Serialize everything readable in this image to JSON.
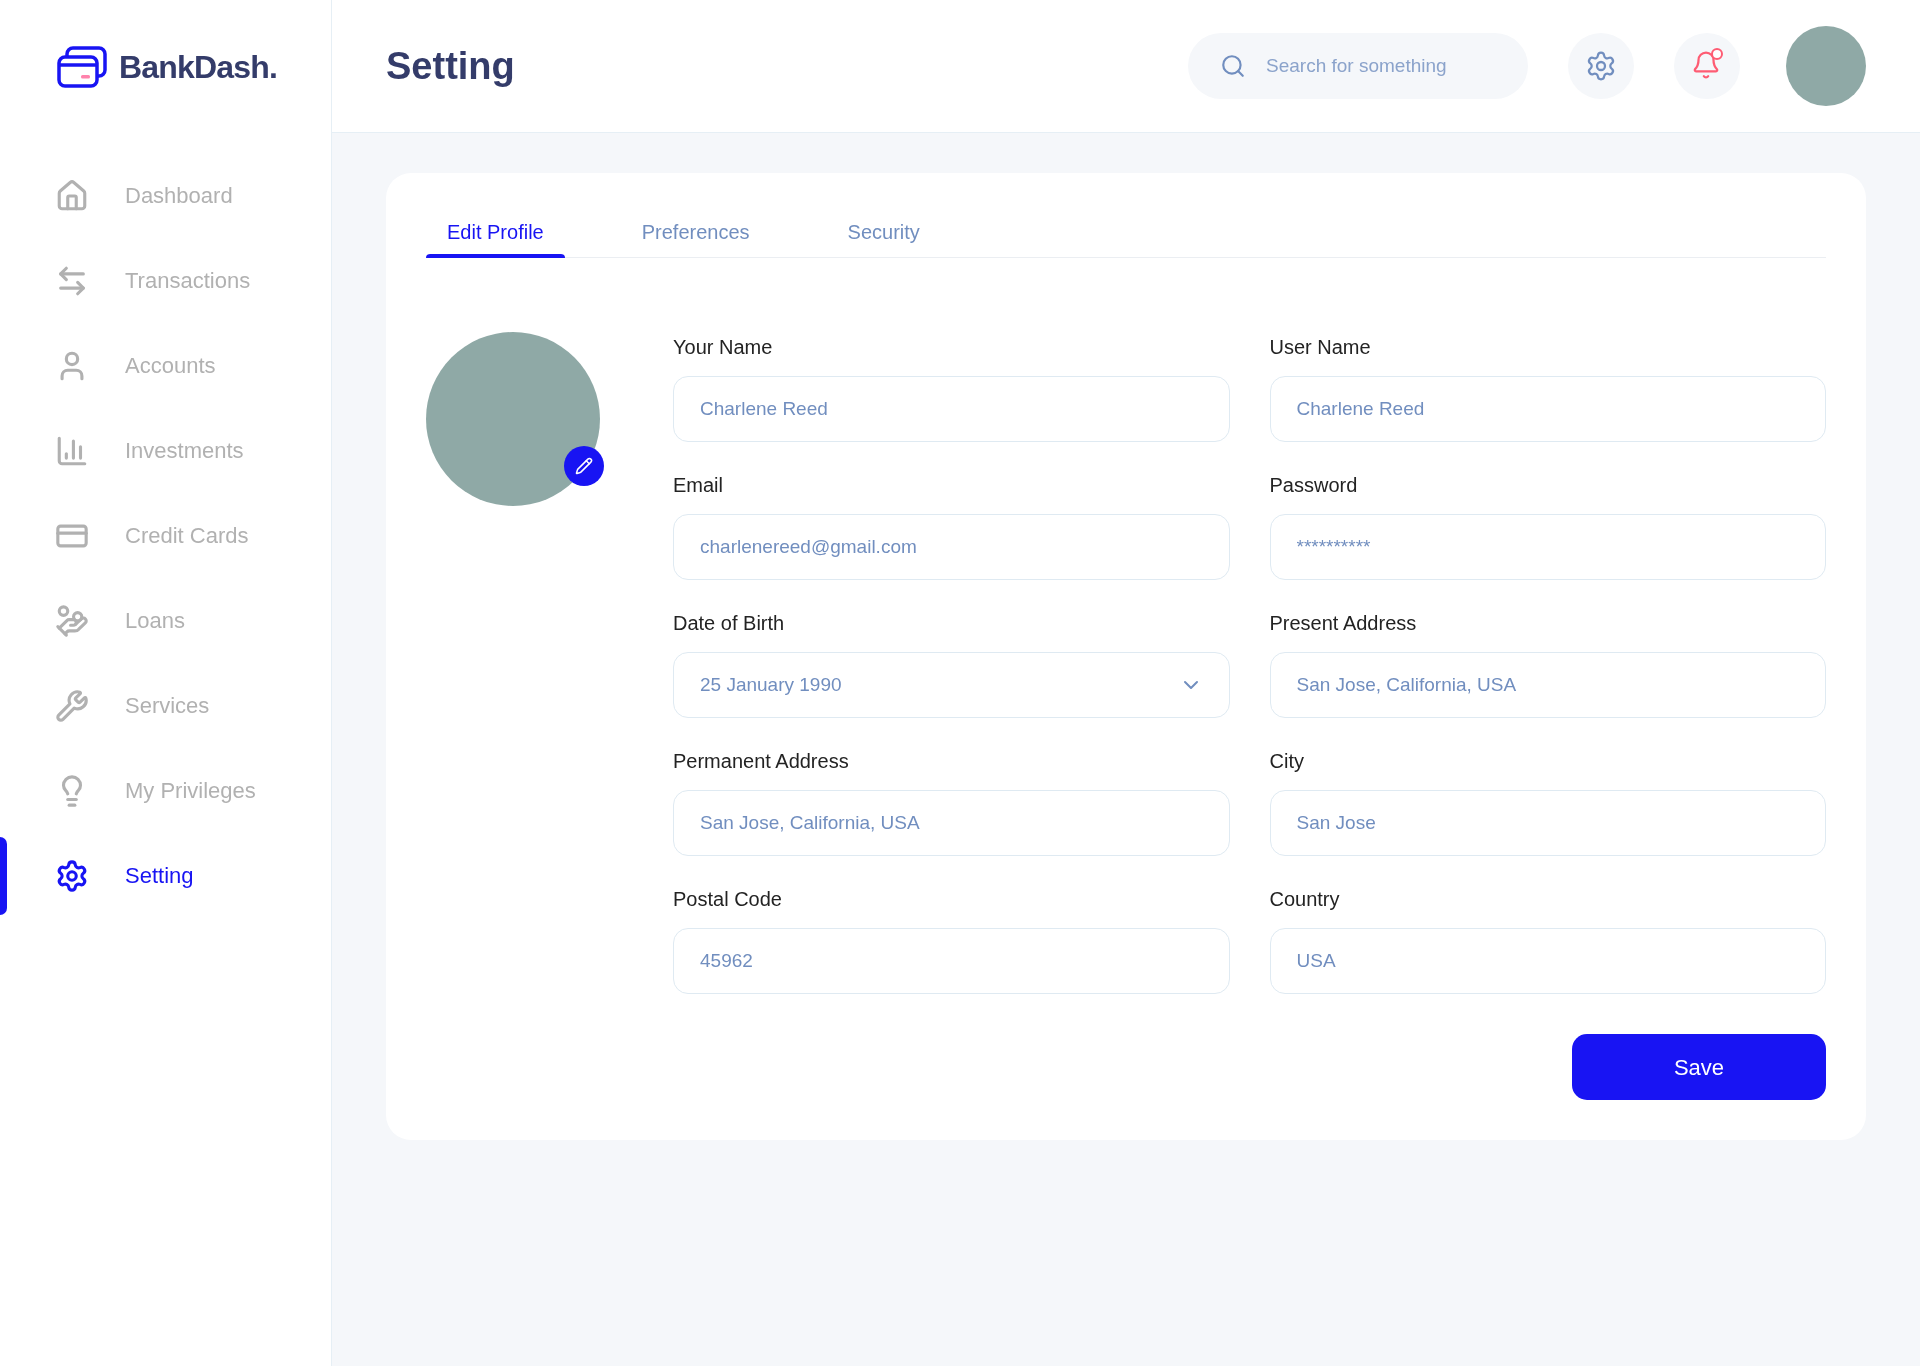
{
  "logo": {
    "name": "BankDash."
  },
  "sidebar": {
    "items": [
      {
        "label": "Dashboard",
        "selected": false
      },
      {
        "label": "Transactions",
        "selected": false
      },
      {
        "label": "Accounts",
        "selected": false
      },
      {
        "label": "Investments",
        "selected": false
      },
      {
        "label": "Credit Cards",
        "selected": false
      },
      {
        "label": "Loans",
        "selected": false
      },
      {
        "label": "Services",
        "selected": false
      },
      {
        "label": "My Privileges",
        "selected": false
      },
      {
        "label": "Setting",
        "selected": true
      }
    ]
  },
  "header": {
    "title": "Setting",
    "search": {
      "placeholder": "Search for something"
    },
    "notification_dot": true
  },
  "tabs": [
    {
      "label": "Edit Profile",
      "selected": true
    },
    {
      "label": "Preferences",
      "selected": false
    },
    {
      "label": "Security",
      "selected": false
    }
  ],
  "form": {
    "fields": [
      {
        "label": "Your Name",
        "value": "Charlene Reed",
        "kind": "text"
      },
      {
        "label": "User Name",
        "value": "Charlene Reed",
        "kind": "text"
      },
      {
        "label": "Email",
        "value": "charlenereed@gmail.com",
        "kind": "text"
      },
      {
        "label": "Password",
        "value": "**********",
        "kind": "text"
      },
      {
        "label": "Date of Birth",
        "value": "25 January 1990",
        "kind": "select"
      },
      {
        "label": "Present Address",
        "value": "San Jose, California, USA",
        "kind": "text"
      },
      {
        "label": "Permanent Address",
        "value": "San Jose, California, USA",
        "kind": "text"
      },
      {
        "label": "City",
        "value": "San Jose",
        "kind": "text"
      },
      {
        "label": "Postal Code",
        "value": "45962",
        "kind": "text"
      },
      {
        "label": "Country",
        "value": "USA",
        "kind": "text"
      }
    ],
    "save_button": "Save"
  }
}
